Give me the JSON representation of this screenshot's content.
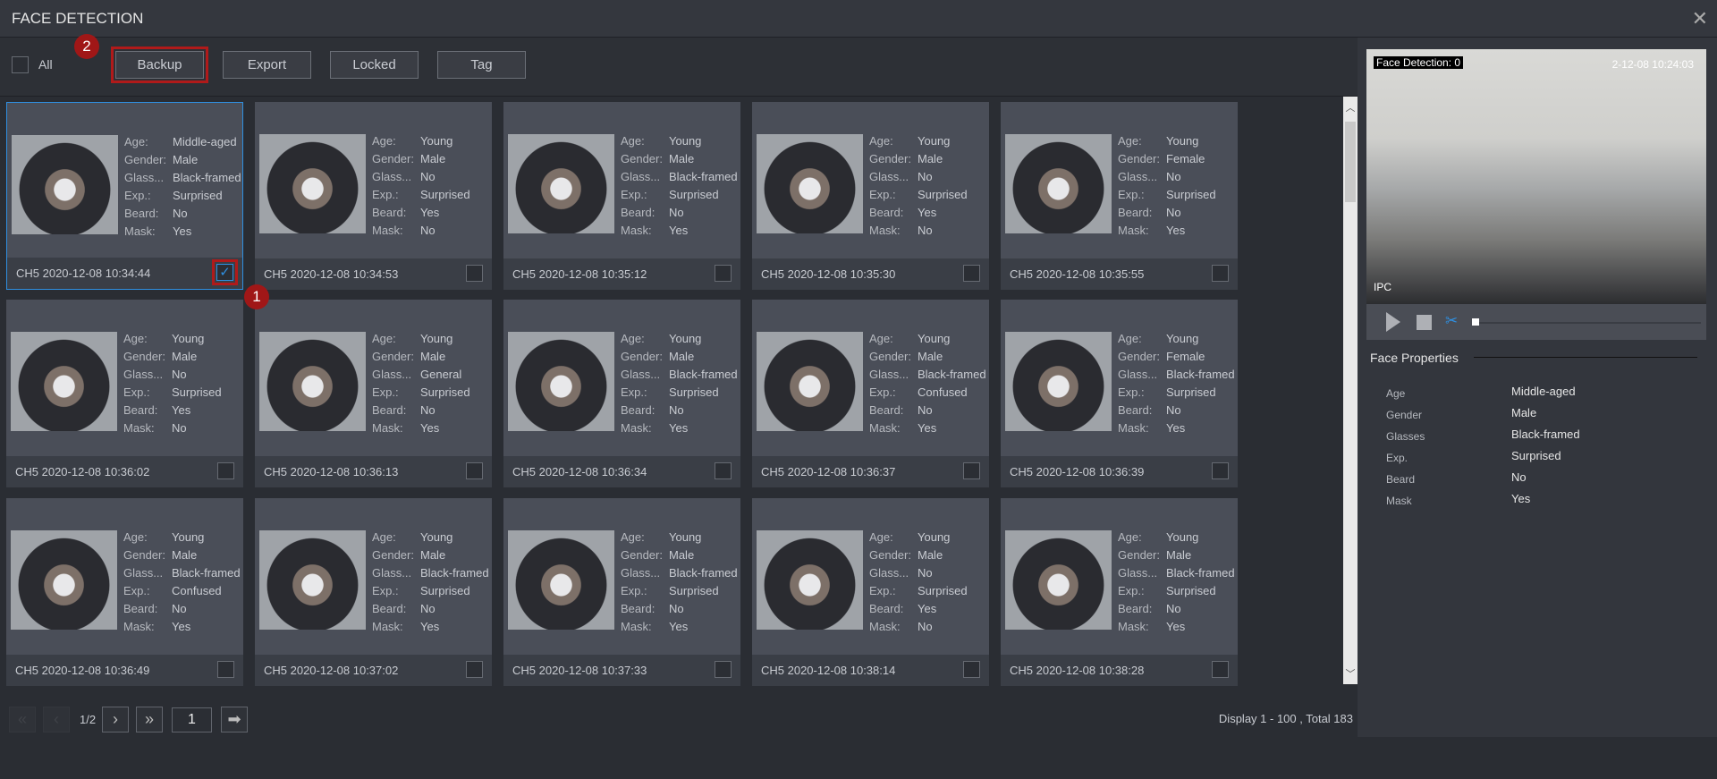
{
  "title": "FACE DETECTION",
  "toolbar": {
    "all_label": "All",
    "buttons": [
      "Backup",
      "Export",
      "Locked",
      "Tag"
    ]
  },
  "annotations": [
    "1",
    "2"
  ],
  "attr_labels": [
    "Age:",
    "Gender:",
    "Glass...",
    "Exp.:",
    "Beard:",
    "Mask:"
  ],
  "cards": [
    {
      "ts": "CH5 2020-12-08 10:34:44",
      "v": [
        "Middle-aged",
        "Male",
        "Black-framed",
        "Surprised",
        "No",
        "Yes"
      ],
      "checked": true
    },
    {
      "ts": "CH5 2020-12-08 10:34:53",
      "v": [
        "Young",
        "Male",
        "No",
        "Surprised",
        "Yes",
        "No"
      ]
    },
    {
      "ts": "CH5 2020-12-08 10:35:12",
      "v": [
        "Young",
        "Male",
        "Black-framed",
        "Surprised",
        "No",
        "Yes"
      ]
    },
    {
      "ts": "CH5 2020-12-08 10:35:30",
      "v": [
        "Young",
        "Male",
        "No",
        "Surprised",
        "Yes",
        "No"
      ]
    },
    {
      "ts": "CH5 2020-12-08 10:35:55",
      "v": [
        "Young",
        "Female",
        "No",
        "Surprised",
        "No",
        "Yes"
      ]
    },
    {
      "ts": "CH5 2020-12-08 10:36:02",
      "v": [
        "Young",
        "Male",
        "No",
        "Surprised",
        "Yes",
        "No"
      ]
    },
    {
      "ts": "CH5 2020-12-08 10:36:13",
      "v": [
        "Young",
        "Male",
        "General",
        "Surprised",
        "No",
        "Yes"
      ]
    },
    {
      "ts": "CH5 2020-12-08 10:36:34",
      "v": [
        "Young",
        "Male",
        "Black-framed",
        "Surprised",
        "No",
        "Yes"
      ]
    },
    {
      "ts": "CH5 2020-12-08 10:36:37",
      "v": [
        "Young",
        "Male",
        "Black-framed",
        "Confused",
        "No",
        "Yes"
      ]
    },
    {
      "ts": "CH5 2020-12-08 10:36:39",
      "v": [
        "Young",
        "Female",
        "Black-framed",
        "Surprised",
        "No",
        "Yes"
      ]
    },
    {
      "ts": "CH5 2020-12-08 10:36:49",
      "v": [
        "Young",
        "Male",
        "Black-framed",
        "Confused",
        "No",
        "Yes"
      ]
    },
    {
      "ts": "CH5 2020-12-08 10:37:02",
      "v": [
        "Young",
        "Male",
        "Black-framed",
        "Surprised",
        "No",
        "Yes"
      ]
    },
    {
      "ts": "CH5 2020-12-08 10:37:33",
      "v": [
        "Young",
        "Male",
        "Black-framed",
        "Surprised",
        "No",
        "Yes"
      ]
    },
    {
      "ts": "CH5 2020-12-08 10:38:14",
      "v": [
        "Young",
        "Male",
        "No",
        "Surprised",
        "Yes",
        "No"
      ]
    },
    {
      "ts": "CH5 2020-12-08 10:38:28",
      "v": [
        "Young",
        "Male",
        "Black-framed",
        "Surprised",
        "No",
        "Yes"
      ]
    }
  ],
  "pager": {
    "page": "1/2",
    "input": "1",
    "display": "Display 1 - 100 , Total 183"
  },
  "video": {
    "overlay_detect": "Face Detection: 0",
    "overlay_time": "2-12-08 10:24:03",
    "overlay_cam": "IPC"
  },
  "face_properties": {
    "title": "Face Properties",
    "rows": [
      {
        "k": "Age",
        "v": "Middle-aged"
      },
      {
        "k": "Gender",
        "v": "Male"
      },
      {
        "k": "Glasses",
        "v": "Black-framed"
      },
      {
        "k": "Exp.",
        "v": "Surprised"
      },
      {
        "k": "Beard",
        "v": "No"
      },
      {
        "k": "Mask",
        "v": "Yes"
      }
    ]
  }
}
